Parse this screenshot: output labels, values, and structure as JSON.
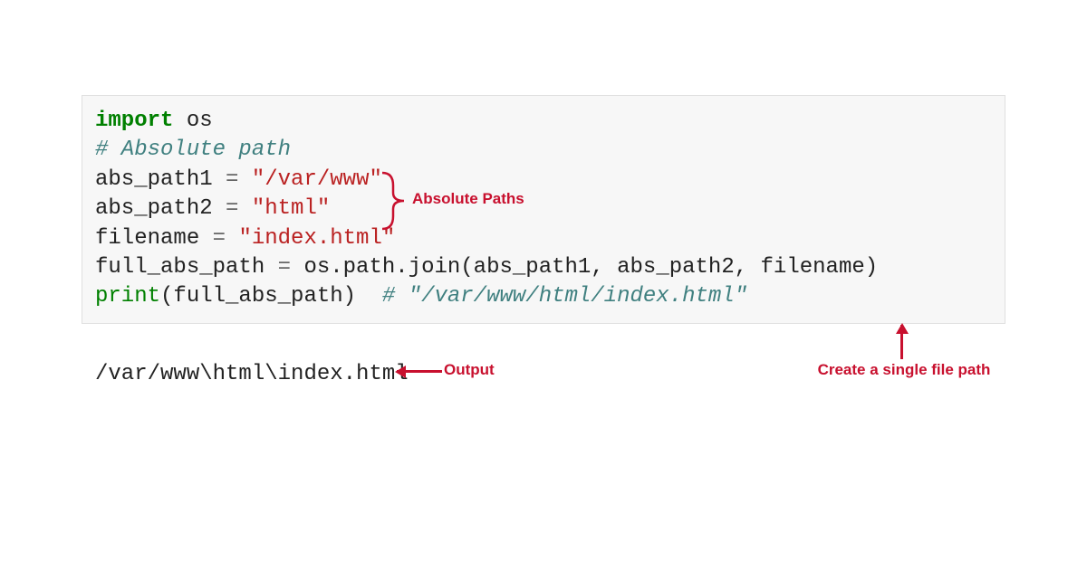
{
  "code": {
    "line1_import": "import",
    "line1_module": " os",
    "blank": "",
    "line3_comment": "# Absolute path",
    "line4_lhs": "abs_path1 ",
    "line4_eq": "=",
    "line4_sp": " ",
    "line4_str": "\"/var/www\"",
    "line5_lhs": "abs_path2 ",
    "line5_eq": "=",
    "line5_sp": " ",
    "line5_str": "\"html\"",
    "line6_lhs": "filename ",
    "line6_eq": "=",
    "line6_sp": " ",
    "line6_str": "\"index.html\"",
    "line7_lhs": "full_abs_path ",
    "line7_eq": "=",
    "line7_rhs": " os.path.join(abs_path1, abs_path2, filename)",
    "line8_print": "print",
    "line8_args": "(full_abs_path)  ",
    "line8_comment": "# \"/var/www/html/index.html\""
  },
  "output": "/var/www\\html\\index.html",
  "annotations": {
    "absolute_paths": "Absolute Paths",
    "output_label": "Output",
    "create_path": "Create a single file path"
  }
}
